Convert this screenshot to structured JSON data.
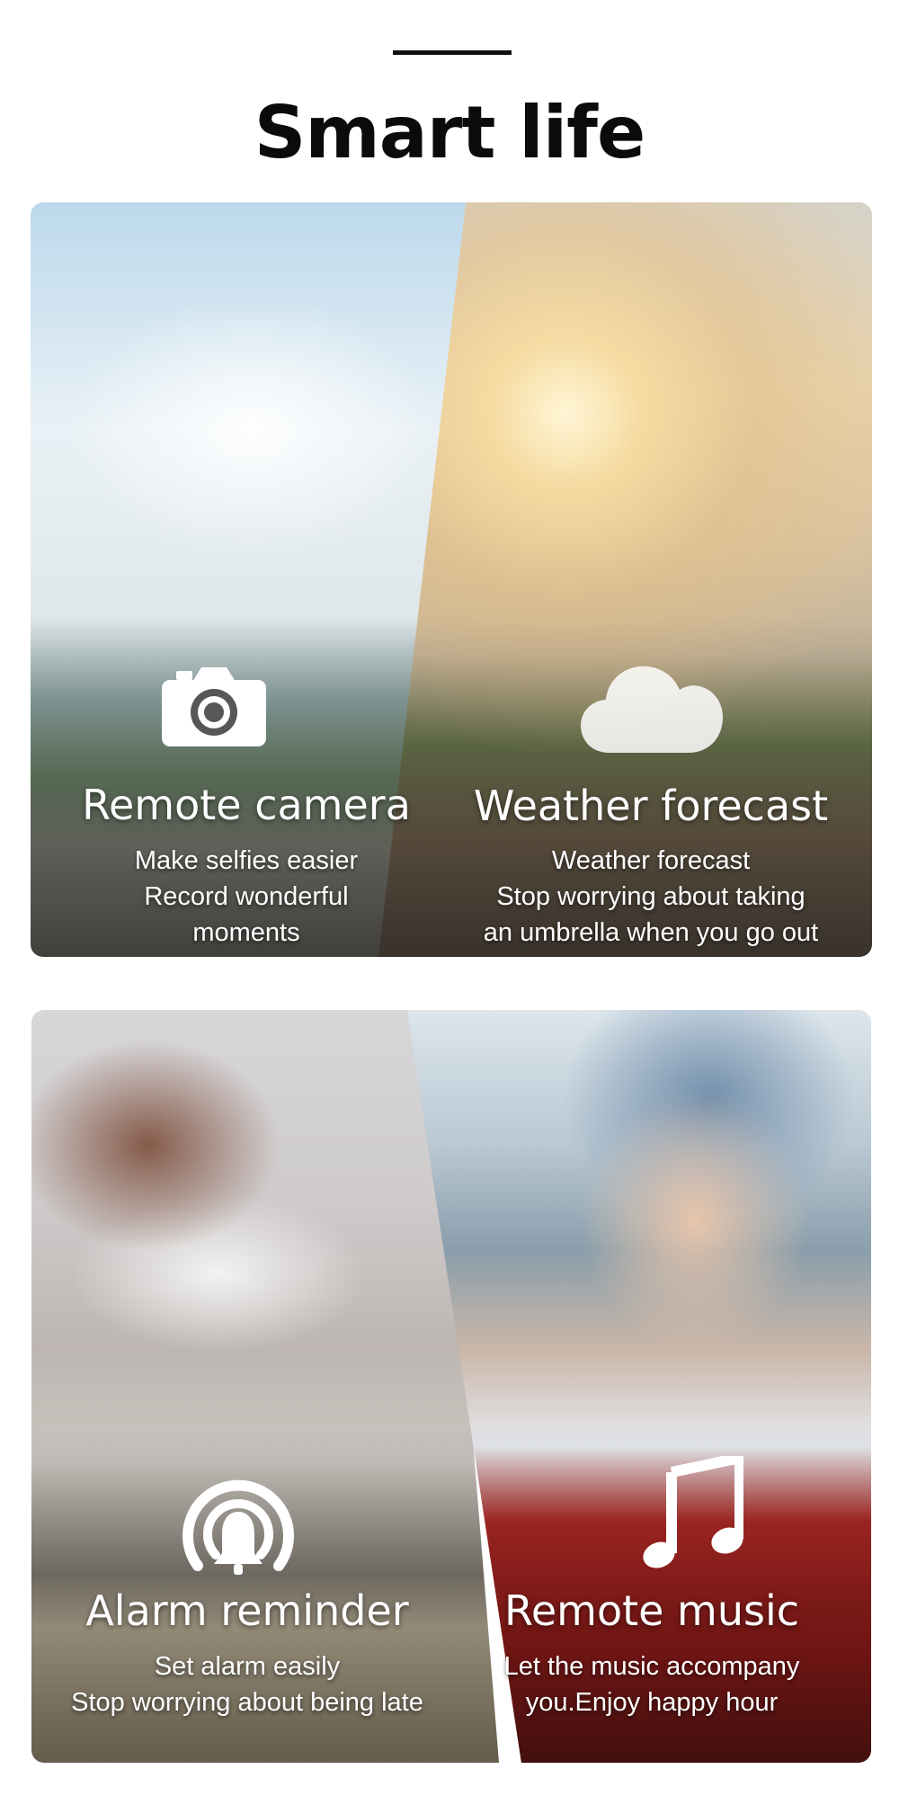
{
  "header": {
    "title": "Smart life"
  },
  "features": [
    {
      "title": "Remote camera",
      "description": [
        "Make selfies easier",
        "Record wonderful",
        "moments"
      ],
      "icon": "camera-icon"
    },
    {
      "title": "Weather forecast",
      "description": [
        "Weather forecast",
        "Stop worrying about taking",
        "an umbrella when you go out"
      ],
      "icon": "cloud-icon"
    },
    {
      "title": "Alarm reminder",
      "description": [
        "Set alarm easily",
        "Stop worrying about being late"
      ],
      "icon": "bell-icon"
    },
    {
      "title": "Remote music",
      "description": [
        "Let the music accompany",
        "you.Enjoy happy hour"
      ],
      "icon": "music-note-icon"
    }
  ],
  "colors": {
    "text_on_image": "#ffffff",
    "title": "#0b0b0b",
    "background": "#ffffff"
  }
}
